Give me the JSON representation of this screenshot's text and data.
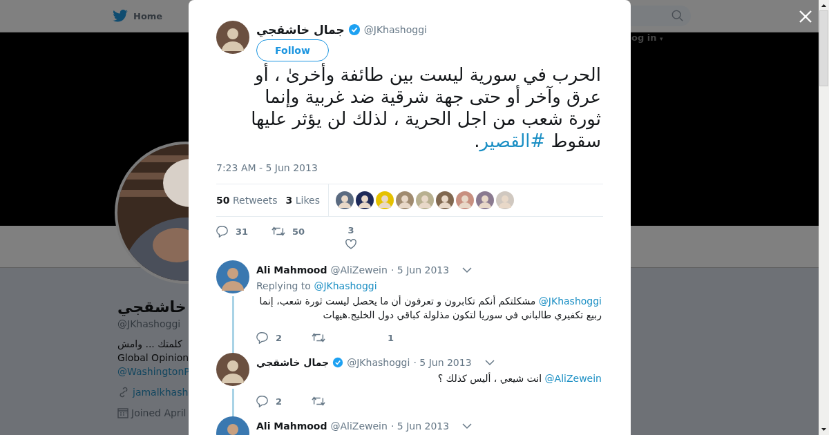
{
  "background": {
    "nav": {
      "home": "Home",
      "login": "og in",
      "login_caret": "▾"
    },
    "profile": {
      "name": "خاشقجي",
      "handle": "@JKhashoggi",
      "bio": "كلمتك ... وامش",
      "bio_line2": "Global Opinion",
      "bio_link": "@WashingtonP",
      "url": "jamalkhash",
      "joined": "Joined April"
    }
  },
  "tweet": {
    "author": {
      "name": "جمال خاشقجي",
      "verified": true,
      "handle": "@JKhashoggi"
    },
    "follow": "Follow",
    "text": "الحرب في سورية ليست بين طائفة وأخرىٰ ، أو عرق وآخر أو حتى جهة شرقية ضد غربية وإنما ثورة شعب من اجل الحرية ، لذلك لن يؤثر عليها سقوط",
    "hashtag": "#القصير",
    "suffix": ".",
    "time": "7:23 AM - 5 Jun 2013",
    "retweets_count": "50",
    "retweets_label": "Retweets",
    "likes_count": "3",
    "likes_label": "Likes",
    "actions": {
      "replies": "31",
      "retweets": "50",
      "likes": "3"
    }
  },
  "replies": [
    {
      "name": "Ali Mahmood",
      "verified": false,
      "handle": "@AliZewein",
      "date": "· 5 Jun 2013",
      "replying_label": "Replying to",
      "replying_to": "@JKhashoggi",
      "mention": "@JKhashoggi",
      "text": "مشكلتكم أنكم تكابرون و تعرفون أن ما يحصل ليست ثورة شعب، إنما ربيع تكفيري طالباني في سوريا لتكون مذلولة كباقي دول الخليج.هيهات",
      "replies": "2",
      "likes": "1",
      "thread": true
    },
    {
      "name": "جمال خاشقجي",
      "verified": true,
      "handle": "@JKhashoggi",
      "date": "· 5 Jun 2013",
      "mention": "@AliZewein",
      "text": "انت شيعي ، أليس كذلك ؟",
      "replies": "2",
      "thread": true
    },
    {
      "name": "Ali Mahmood",
      "verified": false,
      "handle": "@AliZewein",
      "date": "· 5 Jun 2013",
      "thread": false
    }
  ]
}
